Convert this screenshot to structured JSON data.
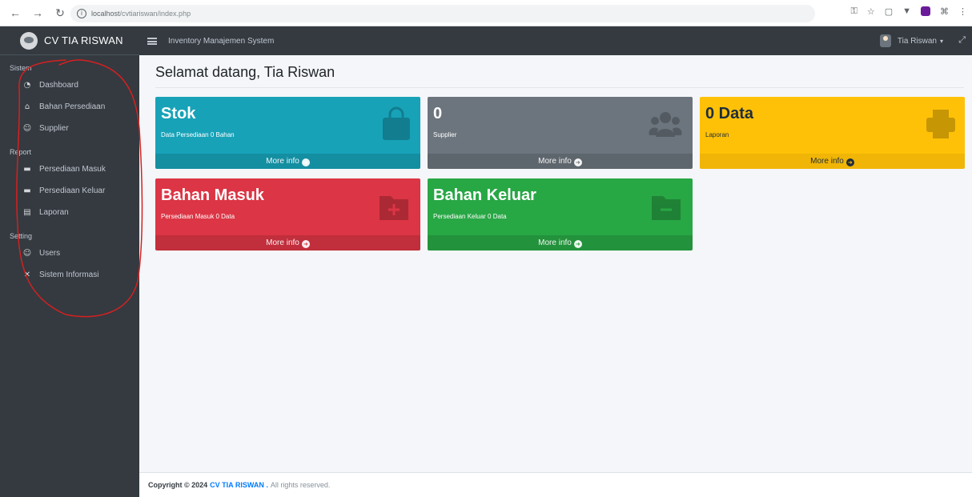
{
  "browser": {
    "url_host": "localhost",
    "url_path": "/cvtiariswan/index.php",
    "info_icon": "i"
  },
  "brand": {
    "name": "CV TIA RISWAN"
  },
  "sidebar": {
    "sections": [
      {
        "label": "Sistem",
        "items": [
          {
            "label": "Dashboard",
            "icon": "tachometer-icon",
            "glyph": "◔"
          },
          {
            "label": "Bahan Persediaan",
            "icon": "landmark-icon",
            "glyph": "⌂"
          },
          {
            "label": "Supplier",
            "icon": "users-icon",
            "glyph": "☺"
          }
        ]
      },
      {
        "label": "Report",
        "items": [
          {
            "label": "Persediaan Masuk",
            "icon": "folder-plus-icon",
            "glyph": "▬"
          },
          {
            "label": "Persediaan Keluar",
            "icon": "folder-minus-icon",
            "glyph": "▬"
          },
          {
            "label": "Laporan",
            "icon": "print-icon",
            "glyph": "▤"
          }
        ]
      },
      {
        "label": "Setting",
        "items": [
          {
            "label": "Users",
            "icon": "users-cog-icon",
            "glyph": "☺"
          },
          {
            "label": "Sistem Informasi",
            "icon": "tools-icon",
            "glyph": "✕"
          }
        ]
      }
    ]
  },
  "topbar": {
    "title": "Inventory Manajemen System",
    "user_name": "Tia Riswan",
    "caret": "▾",
    "expand_glyph": "⤢"
  },
  "main": {
    "page_title": "Selamat datang, Tia Riswan",
    "boxes": [
      {
        "title": "Stok",
        "subtitle": "Data Persediaan 0 Bahan",
        "link": "More info",
        "color": "#17a2b8",
        "icon": "shopping-bag-icon"
      },
      {
        "title": "0",
        "subtitle": "Supplier",
        "link": "More info",
        "color": "#6c757d",
        "icon": "users-icon"
      },
      {
        "title": "0 Data",
        "subtitle": "Laporan",
        "link": "More info",
        "color": "#ffc107",
        "icon": "print-icon"
      },
      {
        "title": "Bahan Masuk",
        "subtitle": "Persediaan Masuk 0 Data",
        "link": "More info",
        "color": "#dc3545",
        "icon": "folder-plus-icon"
      },
      {
        "title": "Bahan Keluar",
        "subtitle": "Persediaan Keluar 0 Data",
        "link": "More info",
        "color": "#28a745",
        "icon": "folder-minus-icon"
      }
    ],
    "arrow_glyph": "➜"
  },
  "footer": {
    "copyright": "Copyright © 2024",
    "brand": "CV TIA RISWAN .",
    "rights": "All rights reserved."
  }
}
